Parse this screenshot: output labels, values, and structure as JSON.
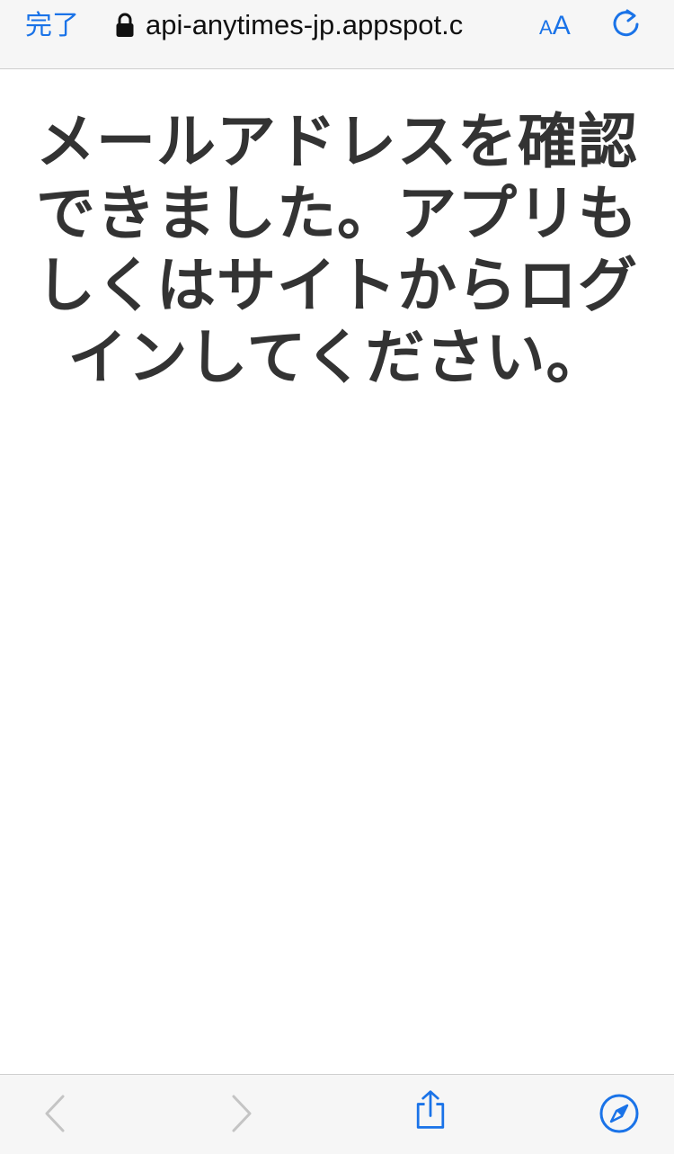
{
  "topbar": {
    "done_label": "完了",
    "url": "api-anytimes-jp.appspot.c",
    "aa_small": "A",
    "aa_big": "A",
    "accent_color": "#1a73e8",
    "icons": {
      "lock": "lock-icon",
      "reload": "reload-icon"
    }
  },
  "main": {
    "message": "メールアドレスを確認できました。アプリもしくはサイトからログインしてください。"
  },
  "toolbar": {
    "icons": {
      "back": "chevron-left-icon",
      "forward": "chevron-right-icon",
      "share": "share-icon",
      "safari": "compass-icon"
    },
    "disabled_color": "#c4c4c4"
  }
}
